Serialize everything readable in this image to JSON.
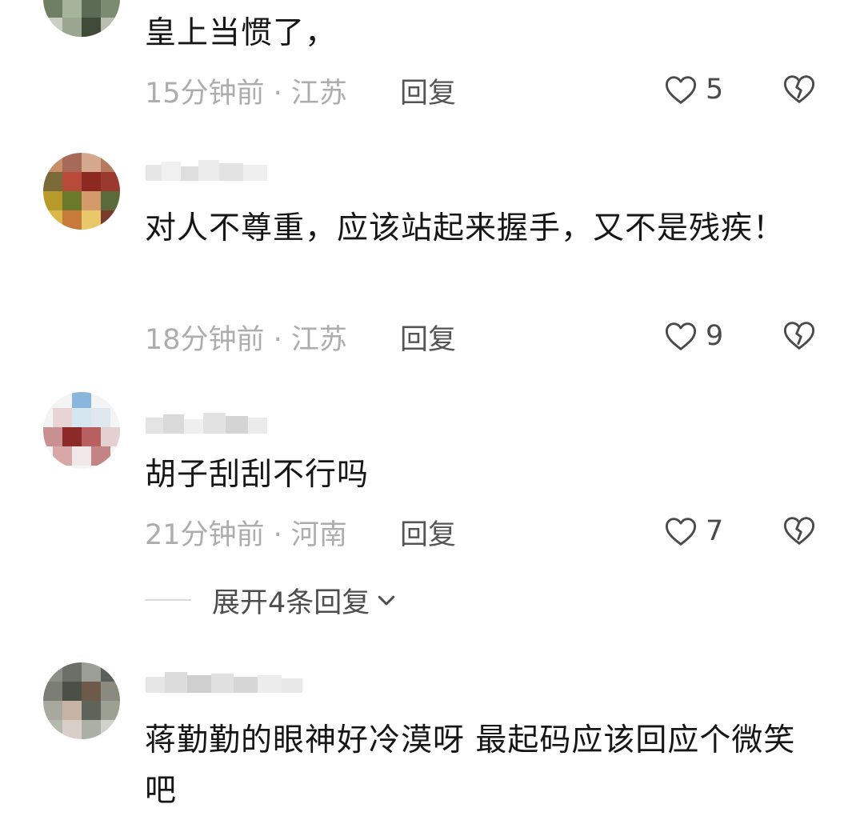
{
  "comments": [
    {
      "text": "皇上当惯了，",
      "time_location": "15分钟前 · 江苏",
      "reply_label": "回复",
      "likes": "5"
    },
    {
      "text": "对人不尊重，应该站起来握手，又不是残疾！",
      "time_location": "18分钟前 · 江苏",
      "reply_label": "回复",
      "likes": "9"
    },
    {
      "text": "胡子刮刮不行吗",
      "time_location": "21分钟前 · 河南",
      "reply_label": "回复",
      "likes": "7"
    },
    {
      "text": "蒋勤勤的眼神好冷漠呀 最起码应该回应个微笑吧"
    }
  ],
  "expand_replies": {
    "label": "展开4条回复"
  },
  "icons": {
    "like": "heart-outline-icon",
    "dislike": "broken-heart-icon",
    "expand": "chevron-down-icon"
  },
  "colors": {
    "text": "#161616",
    "meta": "#adadad",
    "reply": "#545454",
    "icon": "#4a4a4a"
  }
}
